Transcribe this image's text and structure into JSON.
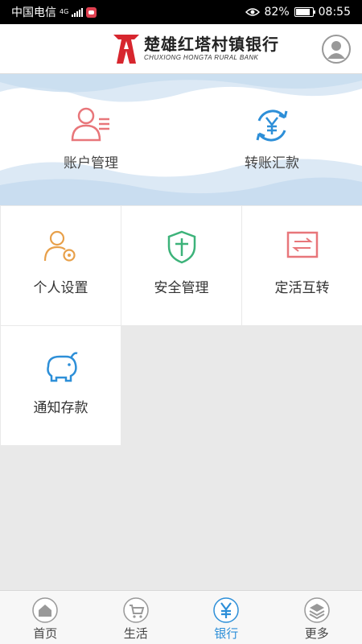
{
  "status_bar": {
    "carrier": "中国电信",
    "network": "4G",
    "battery": "82%",
    "time": "08:55"
  },
  "header": {
    "bank_name_cn": "楚雄红塔村镇银行",
    "bank_name_en": "CHUXIONG HONGTA RURAL BANK"
  },
  "banner": {
    "items": [
      {
        "label": "账户管理",
        "icon": "account-person-icon",
        "color": "#e8767a"
      },
      {
        "label": "转账汇款",
        "icon": "transfer-yuan-icon",
        "color": "#2d8fd8"
      }
    ]
  },
  "grid": {
    "items": [
      {
        "label": "个人设置",
        "icon": "person-settings-icon",
        "color": "#e8a04a"
      },
      {
        "label": "安全管理",
        "icon": "security-shield-icon",
        "color": "#3db37a"
      },
      {
        "label": "定活互转",
        "icon": "exchange-card-icon",
        "color": "#e8767a"
      },
      {
        "label": "通知存款",
        "icon": "piggy-bank-icon",
        "color": "#2d8fd8"
      }
    ]
  },
  "bottom_nav": {
    "items": [
      {
        "label": "首页",
        "icon": "home-icon",
        "active": false
      },
      {
        "label": "生活",
        "icon": "cart-icon",
        "active": false
      },
      {
        "label": "银行",
        "icon": "bank-yuan-icon",
        "active": true
      },
      {
        "label": "更多",
        "icon": "layers-icon",
        "active": false
      }
    ],
    "active_color": "#2d8fd8"
  }
}
